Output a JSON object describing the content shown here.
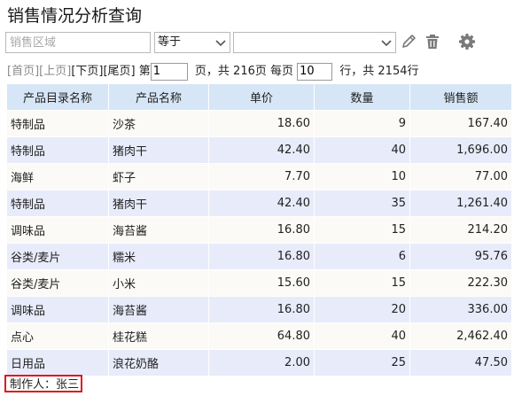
{
  "page_title": "销售情况分析查询",
  "filter": {
    "field_placeholder": "销售区域",
    "operator_value": "等于",
    "value_value": ""
  },
  "pager": {
    "first": "[首页]",
    "prev": "[上页]",
    "next": "[下页]",
    "last": "[尾页]",
    "label_page_prefix": "第",
    "current_page": "1",
    "label_total_pages": "页，共 216页 每页",
    "rows_per_page": "10",
    "label_total_rows": "行，共 2154行"
  },
  "table": {
    "columns": [
      "产品目录名称",
      "产品名称",
      "单价",
      "数量",
      "销售额"
    ],
    "rows": [
      [
        "特制品",
        "沙茶",
        "18.60",
        "9",
        "167.40"
      ],
      [
        "特制品",
        "猪肉干",
        "42.40",
        "40",
        "1,696.00"
      ],
      [
        "海鲜",
        "虾子",
        "7.70",
        "10",
        "77.00"
      ],
      [
        "特制品",
        "猪肉干",
        "42.40",
        "35",
        "1,261.40"
      ],
      [
        "调味品",
        "海苔酱",
        "16.80",
        "15",
        "214.20"
      ],
      [
        "谷类/麦片",
        "糯米",
        "16.80",
        "6",
        "95.76"
      ],
      [
        "谷类/麦片",
        "小米",
        "15.60",
        "15",
        "222.30"
      ],
      [
        "调味品",
        "海苔酱",
        "16.80",
        "20",
        "336.00"
      ],
      [
        "点心",
        "桂花糕",
        "64.80",
        "40",
        "2,462.40"
      ],
      [
        "日用品",
        "浪花奶酪",
        "2.00",
        "25",
        "47.50"
      ]
    ]
  },
  "footer": {
    "author_label": "制作人：张三"
  },
  "icons": {
    "edit": "pencil-icon",
    "delete": "trash-icon",
    "settings": "gear-icon",
    "dropdown": "chevron-down-icon"
  },
  "colors": {
    "header_bg": "#d6e6f6",
    "row_odd_bg": "#fbfaf6",
    "row_even_bg": "#e8ebfa",
    "icon_gray": "#7a7a7a",
    "highlight_border": "#e0191b"
  }
}
